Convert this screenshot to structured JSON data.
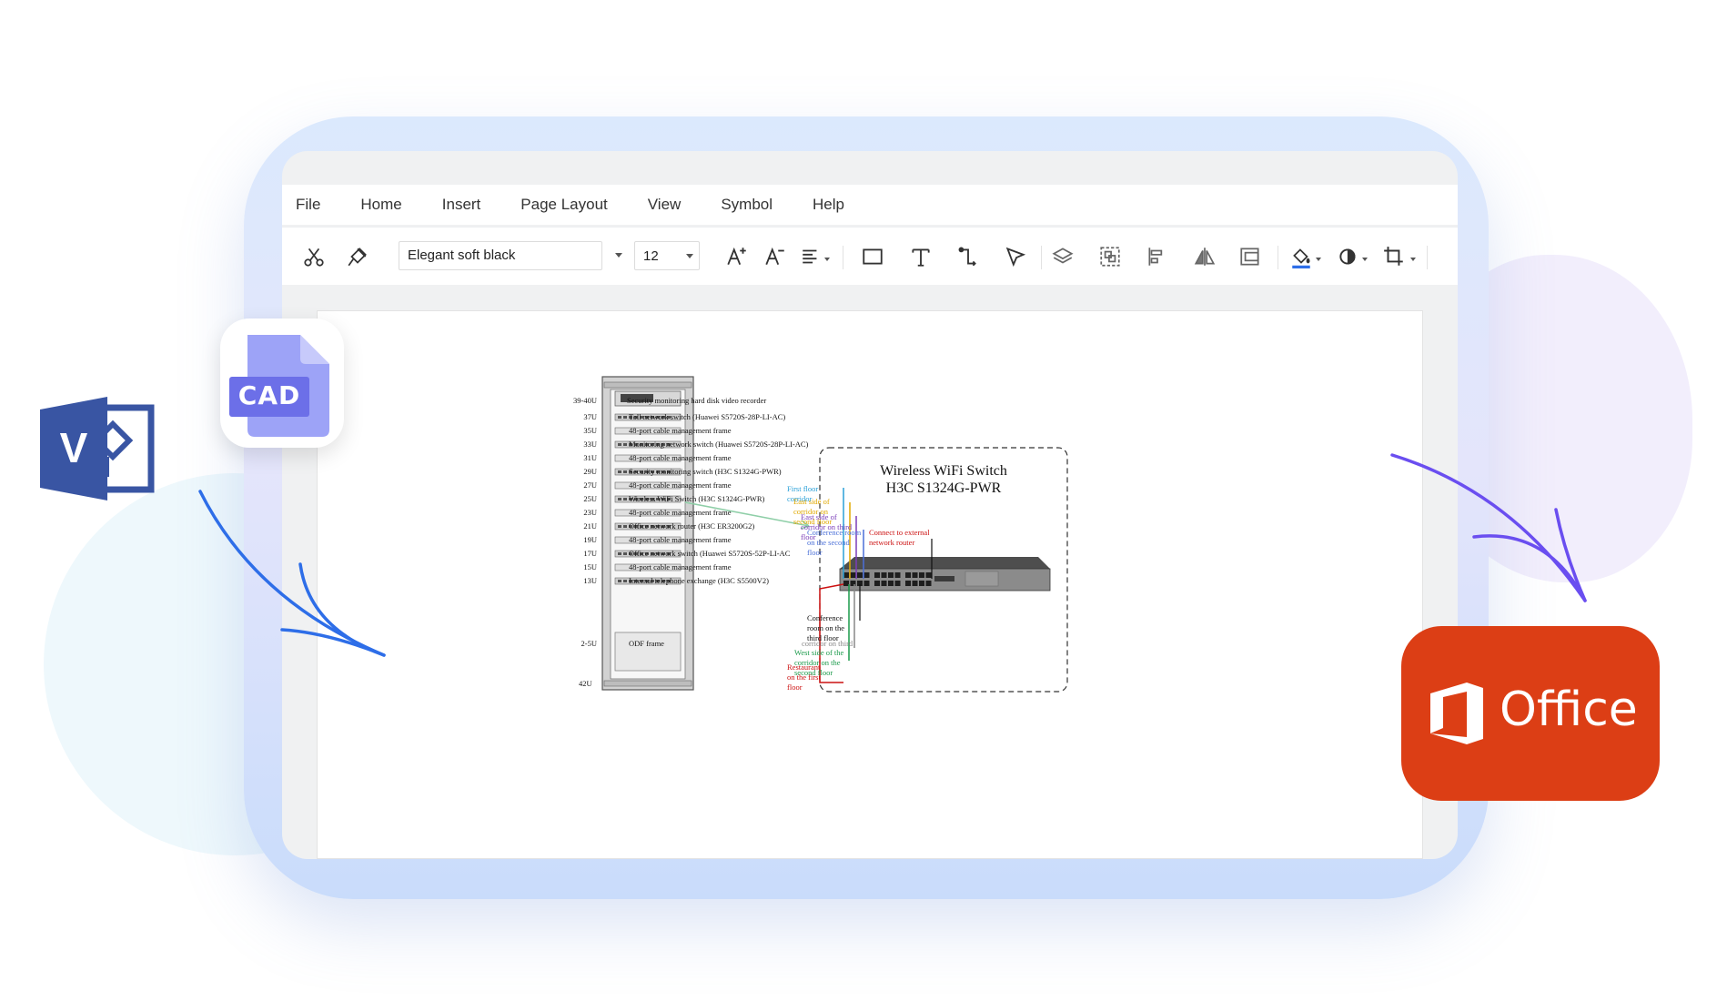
{
  "menu": [
    "File",
    "Home",
    "Insert",
    "Page Layout",
    "View",
    "Symbol",
    "Help"
  ],
  "toolbar": {
    "font_value": "Elegant soft black",
    "size_value": "12",
    "icons": [
      "scissors-icon",
      "format-painter-icon",
      "font-increase-icon",
      "font-decrease-icon",
      "align-icon",
      "rectangle-icon",
      "text-icon",
      "connector-icon",
      "select-pointer-icon",
      "layers-icon",
      "group-icon",
      "align-left-icon",
      "flip-icon",
      "frame-icon",
      "fill-color-icon",
      "shape-style-icon",
      "crop-icon"
    ]
  },
  "rack": {
    "total_label": "42U",
    "rows": [
      {
        "u": "39-40U",
        "desc": "Security monitoring hard disk video recorder"
      },
      {
        "u": "37U",
        "desc": "Toll network switch (Huawei S5720S-28P-LI-AC)"
      },
      {
        "u": "35U",
        "desc": "48-port cable management frame"
      },
      {
        "u": "33U",
        "desc": "Monitoring network switch (Huawei S5720S-28P-LI-AC)"
      },
      {
        "u": "31U",
        "desc": "48-port cable management frame"
      },
      {
        "u": "29U",
        "desc": "Security monitoring switch (H3C S1324G-PWR)"
      },
      {
        "u": "27U",
        "desc": "48-port cable management frame"
      },
      {
        "u": "25U",
        "desc": "Wireless WiFi Switch (H3C S1324G-PWR)"
      },
      {
        "u": "23U",
        "desc": "48-port cable management frame"
      },
      {
        "u": "21U",
        "desc": "Office network router (H3C ER3200G2)"
      },
      {
        "u": "19U",
        "desc": "48-port cable management frame"
      },
      {
        "u": "17U",
        "desc": "Office network switch (Huawei S5720S-52P-LI-AC"
      },
      {
        "u": "15U",
        "desc": "48-port cable management frame"
      },
      {
        "u": "13U",
        "desc": "Internal telephone exchange (H3C S5500V2)"
      },
      {
        "u": "2-5U",
        "desc": "ODF frame"
      }
    ]
  },
  "detail": {
    "title_line1": "Wireless WiFi Switch",
    "title_line2": "H3C S1324G-PWR",
    "annotations": [
      {
        "text": "First floor corridor",
        "color": "#2aa0d8"
      },
      {
        "text": "East side of corridor on second floor",
        "color": "#e0a800"
      },
      {
        "text": "East side of corridor on third floor",
        "color": "#7a3db8"
      },
      {
        "text": "Conference room on the second floor",
        "color": "#4a6fd8"
      },
      {
        "text": "Connect to external network router",
        "color": "#cc1111"
      },
      {
        "text": "Conference room on the third floor",
        "color": "#111111"
      },
      {
        "text": "corridor on third",
        "color": "#888888"
      },
      {
        "text": "West side of the corridor on the second floor",
        "color": "#1a9a4a"
      },
      {
        "text": "Restaurant on the first floor",
        "color": "#cc1111"
      }
    ]
  },
  "badges": {
    "cad": "CAD",
    "visio": "V",
    "office": "Office"
  },
  "colors": {
    "office_red": "#dc3e15",
    "visio_blue": "#3955a3",
    "cad_purple": "#7a7ef0",
    "arrow_blue": "#2e6ee8",
    "arrow_purple": "#6a4ef0"
  }
}
